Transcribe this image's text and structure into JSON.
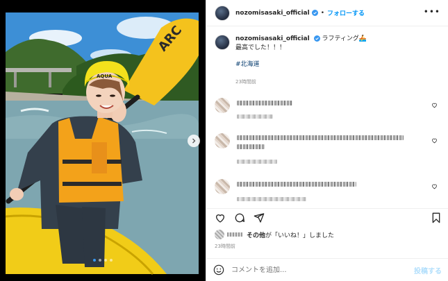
{
  "post": {
    "username": "nozomisasaki_official",
    "follow_label": "フォローする",
    "separator": "•",
    "more_label": "•••",
    "caption_text": "ラフティング🚣",
    "caption_line2": "最高でした！！！",
    "hashtag": "#北海道",
    "caption_time": "23時間前",
    "likes_suffix_bold": "その他",
    "likes_suffix": "が「いいね！」しました",
    "post_time": "23時間前"
  },
  "comment_box": {
    "placeholder": "コメントを追加...",
    "post_label": "投稿する"
  },
  "photo": {
    "helmet_text": "AQUA",
    "paddle_text": "ARC",
    "slide_count": 4,
    "active_slide": 1
  },
  "colors": {
    "accent": "#0095f6",
    "verified": "#3897f0",
    "hashtag": "#00376b",
    "muted": "#8e8e8e"
  },
  "icons": [
    "verified-badge-icon",
    "more-icon",
    "chevron-right-icon",
    "heart-icon",
    "comment-icon",
    "share-icon",
    "bookmark-icon",
    "emoji-icon"
  ]
}
